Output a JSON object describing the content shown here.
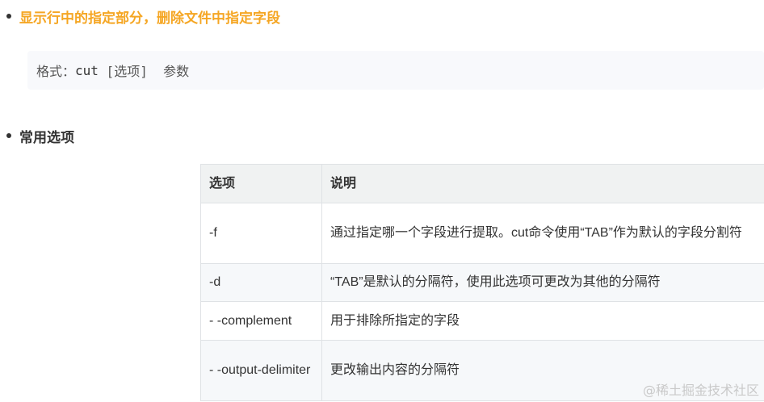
{
  "section1": {
    "heading": "显示行中的指定部分，删除文件中指定字段"
  },
  "code": {
    "label": "格式：",
    "command": "cut",
    "rest": " [选项]  参数"
  },
  "section2": {
    "heading": "常用选项"
  },
  "table": {
    "headers": [
      "选项",
      "说明"
    ],
    "rows": [
      {
        "option": "-f",
        "desc": "通过指定哪一个字段进行提取。cut命令使用“TAB”作为默认的字段分割符"
      },
      {
        "option": "-d",
        "desc": "“TAB”是默认的分隔符，使用此选项可更改为其他的分隔符"
      },
      {
        "option": "- -complement",
        "desc": "用于排除所指定的字段"
      },
      {
        "option": "- -output-delimiter",
        "desc": "更改输出内容的分隔符"
      }
    ]
  },
  "watermark": "@稀土掘金技术社区"
}
